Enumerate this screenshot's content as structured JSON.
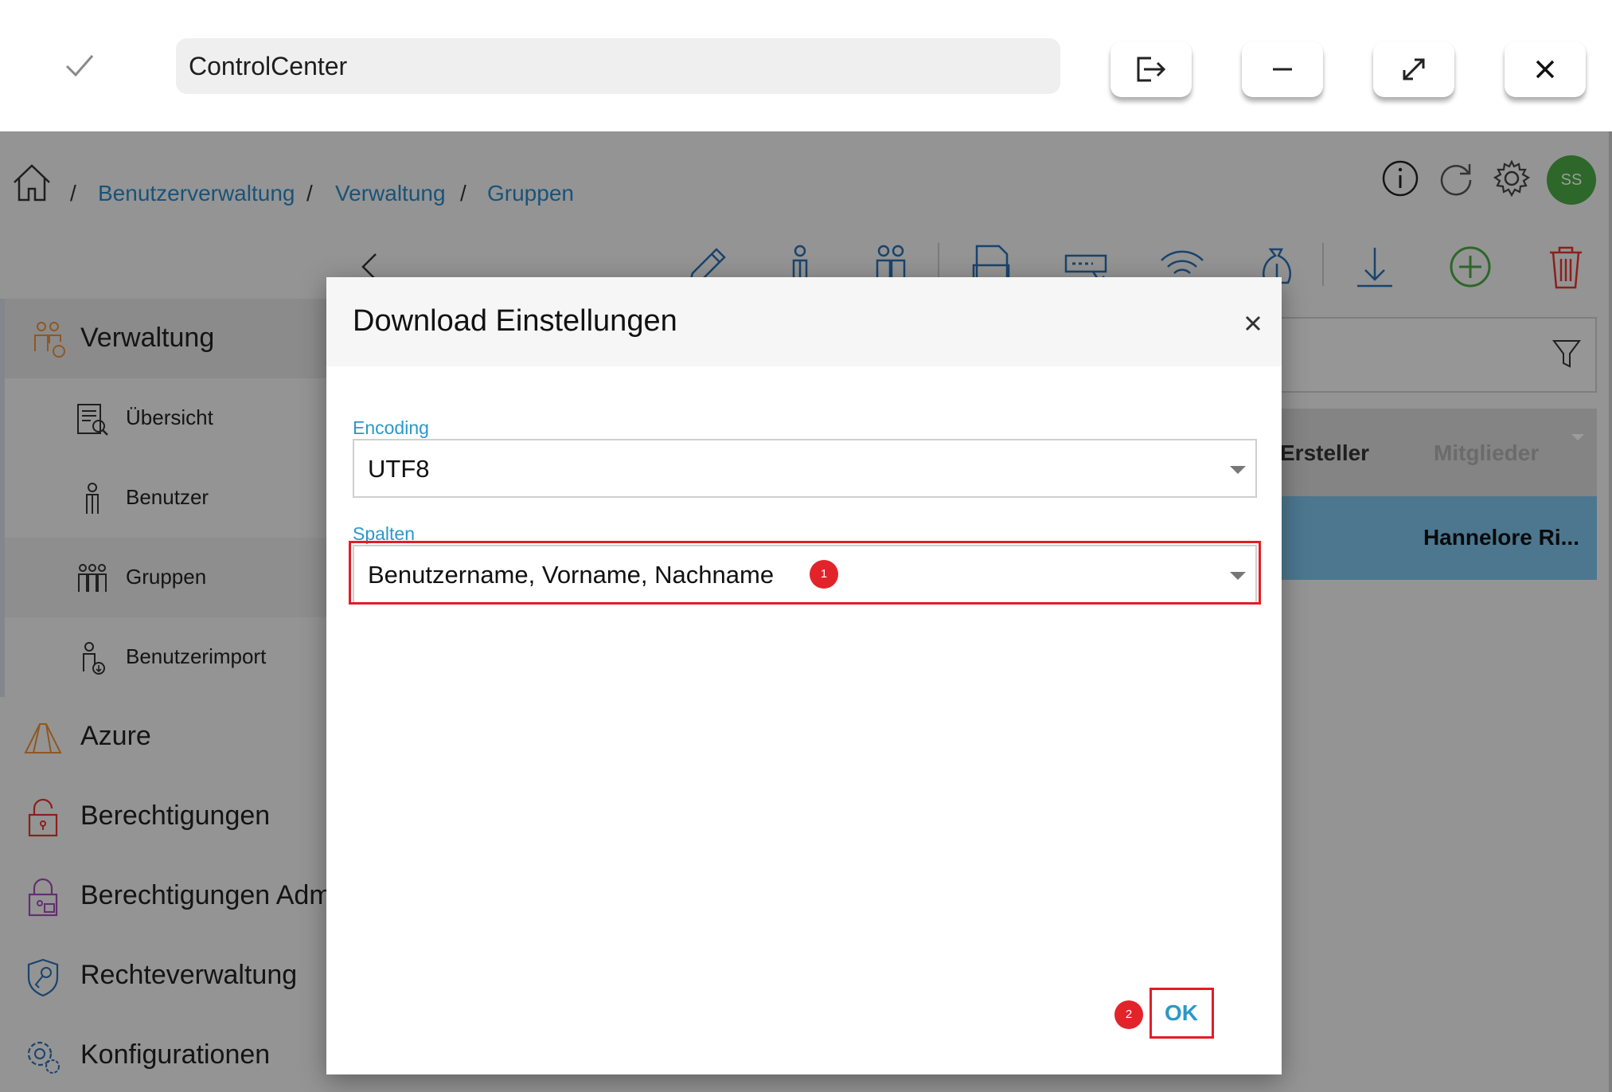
{
  "window": {
    "title": "ControlCenter",
    "icons": [
      "check-icon",
      "logout-icon",
      "minimize-icon",
      "maximize-icon",
      "close-icon"
    ]
  },
  "breadcrumb": {
    "items": [
      "Benutzerverwaltung",
      "Verwaltung",
      "Gruppen"
    ],
    "separator": "/"
  },
  "header": {
    "avatar_initials": "SS",
    "avatar_color": "#4aa843"
  },
  "sidebar": {
    "group": {
      "label": "Verwaltung"
    },
    "sub_items": [
      {
        "label": "Übersicht",
        "icon": "overview-icon"
      },
      {
        "label": "Benutzer",
        "icon": "user-icon"
      },
      {
        "label": "Gruppen",
        "icon": "group-icon",
        "selected": true
      },
      {
        "label": "Benutzerimport",
        "icon": "user-import-icon"
      }
    ],
    "items": [
      {
        "label": "Azure",
        "icon": "azure-icon"
      },
      {
        "label": "Berechtigungen",
        "icon": "lock-icon"
      },
      {
        "label": "Berechtigungen Adm",
        "icon": "lock-admin-icon"
      },
      {
        "label": "Rechteverwaltung",
        "icon": "key-shield-icon"
      },
      {
        "label": "Konfigurationen",
        "icon": "gears-icon"
      }
    ]
  },
  "toolbar": {
    "icons": [
      "edit-icon",
      "user-icon",
      "users-icon",
      "pdf-icon",
      "password-icon",
      "wifi-icon",
      "money-icon",
      "download-icon",
      "add-icon",
      "delete-icon"
    ]
  },
  "grid": {
    "columns": [
      "Ersteller",
      "Mitglieder"
    ],
    "rows": [
      {
        "ersteller": "Hannelore Ri..."
      }
    ]
  },
  "dialog": {
    "title": "Download Einstellungen",
    "encoding": {
      "label": "Encoding",
      "value": "UTF8"
    },
    "spalten": {
      "label": "Spalten",
      "value": "Benutzername, Vorname, Nachname"
    },
    "ok_label": "OK",
    "markers": [
      "1",
      "2"
    ],
    "highlight_color": "#e21d25"
  }
}
